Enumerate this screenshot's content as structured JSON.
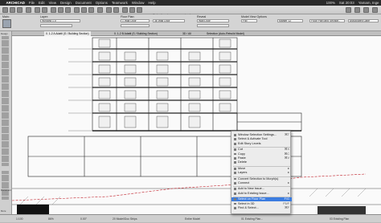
{
  "menubar": {
    "apple": "",
    "app": "ARCHICAD",
    "items": [
      "File",
      "Edit",
      "View",
      "Design",
      "Document",
      "Options",
      "Teamwork",
      "Window",
      "Help"
    ],
    "status": [
      "100%",
      "Sat 20:03",
      "Yamam, Inge"
    ]
  },
  "window_title": "Selection Improvements.pln",
  "infobox": {
    "main_label": "Main:",
    "layer_label": "Layer:",
    "layer_value": "Window 1.0",
    "floor_label": "Floor Plan:",
    "floor_value": "1 Wall Door",
    "dims_value": "36 Wall Door",
    "reveal_label": "Reveal",
    "anchor_value": "Wall Door",
    "model_label": "Model View Options",
    "shows_label": "Flip",
    "marker_value": "Marker 12",
    "flp_label": "Floor Plan and Section..",
    "info_value": "Associated Labe"
  },
  "toolbox": {
    "title": "Design",
    "doc_title": "Document",
    "more_title": "More"
  },
  "tabs": [
    "0. 1-2 A Adatti (S / Building Section)",
    "0. 1-2 B Adatti (S / Building Section)",
    "3D / All",
    "Selection (Auto-Rebuild Model)"
  ],
  "context_menu": {
    "items": [
      {
        "label": "Window Selection Settings...",
        "shortcut": "⌘T"
      },
      {
        "label": "Select & Activate Tool",
        "shortcut": ""
      },
      {
        "label": "Edit Story Levels",
        "shortcut": ""
      },
      {
        "label": "Cut",
        "shortcut": "⌘X"
      },
      {
        "label": "Copy",
        "shortcut": "⌘C"
      },
      {
        "label": "Paste",
        "shortcut": "⌘V"
      },
      {
        "label": "Delete",
        "shortcut": ""
      },
      {
        "label": "Move",
        "shortcut": "▸"
      },
      {
        "label": "Layers",
        "shortcut": "▸"
      },
      {
        "label": "Convert Selection to Morph(s)",
        "shortcut": ""
      },
      {
        "label": "Connect",
        "shortcut": "▸"
      },
      {
        "label": "Add to New Issue...",
        "shortcut": ""
      },
      {
        "label": "Add to Existing Issue...",
        "shortcut": "▸"
      },
      {
        "label": "Select on Floor Plan",
        "shortcut": "F/G"
      },
      {
        "label": "Select in 3D",
        "shortcut": "F5/F"
      },
      {
        "label": "Find & Select...",
        "shortcut": "⌘F"
      }
    ],
    "highlighted_index": 13
  },
  "statusbar": {
    "scale": "1:100",
    "zoom": "86%",
    "angle": "0.00°",
    "layer": "20 Model/Doc Strips",
    "entire": "Entire Model",
    "detail": "01 Existing Plan...",
    "preset": "03 Existing Plan"
  },
  "colors": {
    "highlight": "#3b7ce0",
    "menubar": "#2b2b2b",
    "red_line": "#c0202a"
  }
}
